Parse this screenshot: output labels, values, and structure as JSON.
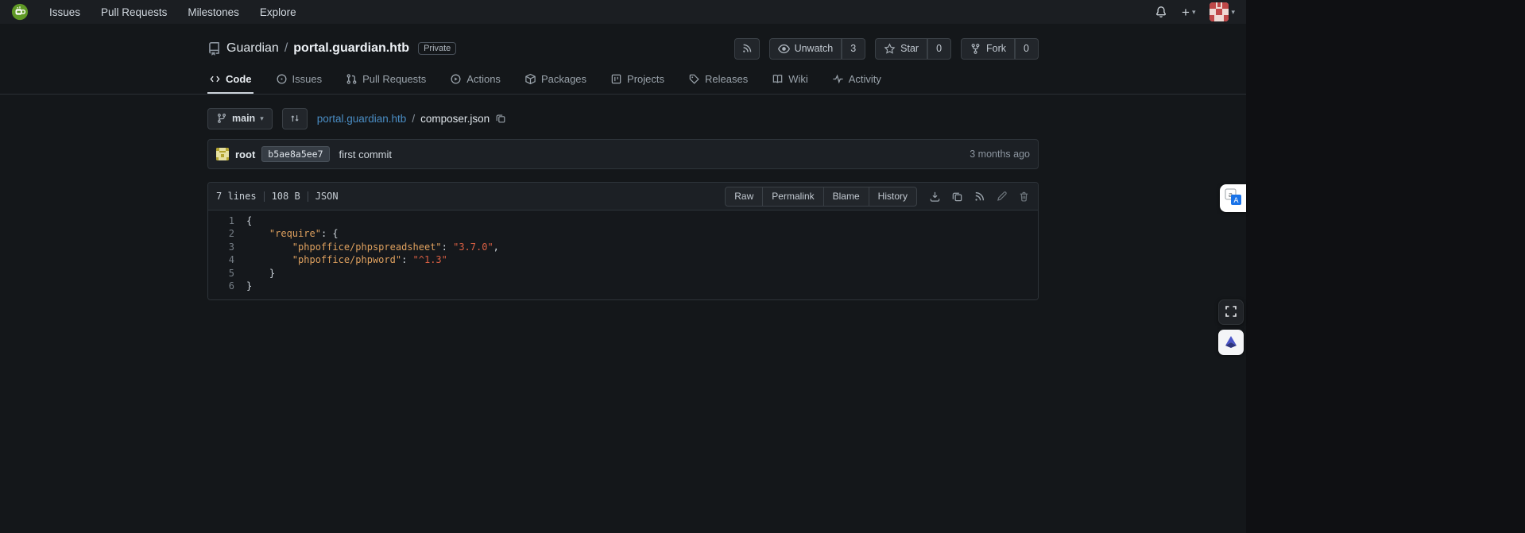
{
  "icons": {
    "caret_down": "▾",
    "plus": "+"
  },
  "colors": {
    "link": "#4a8dc4",
    "accent_green_logo": "#609926",
    "code_p": "#cdd4db",
    "code_key": "#dea05e",
    "code_str": "#d95f43",
    "line_number": "#767e86"
  },
  "navbar": {
    "items": [
      "Issues",
      "Pull Requests",
      "Milestones",
      "Explore"
    ]
  },
  "repo": {
    "owner": "Guardian",
    "separator": "/",
    "name": "portal.guardian.htb",
    "visibility": "Private",
    "actions": {
      "unwatch_label": "Unwatch",
      "unwatch_count": "3",
      "star_label": "Star",
      "star_count": "0",
      "fork_label": "Fork",
      "fork_count": "0"
    }
  },
  "tabs": [
    "Code",
    "Issues",
    "Pull Requests",
    "Actions",
    "Packages",
    "Projects",
    "Releases",
    "Wiki",
    "Activity"
  ],
  "file_nav": {
    "branch": "main",
    "breadcrumb_repo": "portal.guardian.htb",
    "separator": "/",
    "file": "composer.json"
  },
  "commit": {
    "author": "root",
    "hash": "b5ae8a5ee7",
    "message": "first commit",
    "age": "3 months ago"
  },
  "file_header": {
    "lines": "7 lines",
    "size": "108 B",
    "lang": "JSON",
    "buttons": [
      "Raw",
      "Permalink",
      "Blame",
      "History"
    ]
  },
  "code": {
    "lines": [
      {
        "num": "1",
        "tokens": [
          {
            "t": "{",
            "c": "p"
          }
        ]
      },
      {
        "num": "2",
        "tokens": [
          {
            "t": "    ",
            "c": "p"
          },
          {
            "t": "\"require\"",
            "c": "key"
          },
          {
            "t": ": {",
            "c": "p"
          }
        ]
      },
      {
        "num": "3",
        "tokens": [
          {
            "t": "        ",
            "c": "p"
          },
          {
            "t": "\"phpoffice/phpspreadsheet\"",
            "c": "key"
          },
          {
            "t": ": ",
            "c": "p"
          },
          {
            "t": "\"3.7.0\"",
            "c": "str"
          },
          {
            "t": ",",
            "c": "p"
          }
        ]
      },
      {
        "num": "4",
        "tokens": [
          {
            "t": "        ",
            "c": "p"
          },
          {
            "t": "\"phpoffice/phpword\"",
            "c": "key"
          },
          {
            "t": ": ",
            "c": "p"
          },
          {
            "t": "\"^1.3\"",
            "c": "str"
          }
        ]
      },
      {
        "num": "5",
        "tokens": [
          {
            "t": "    }",
            "c": "p"
          }
        ]
      },
      {
        "num": "6",
        "tokens": [
          {
            "t": "}",
            "c": "p"
          }
        ]
      }
    ]
  }
}
